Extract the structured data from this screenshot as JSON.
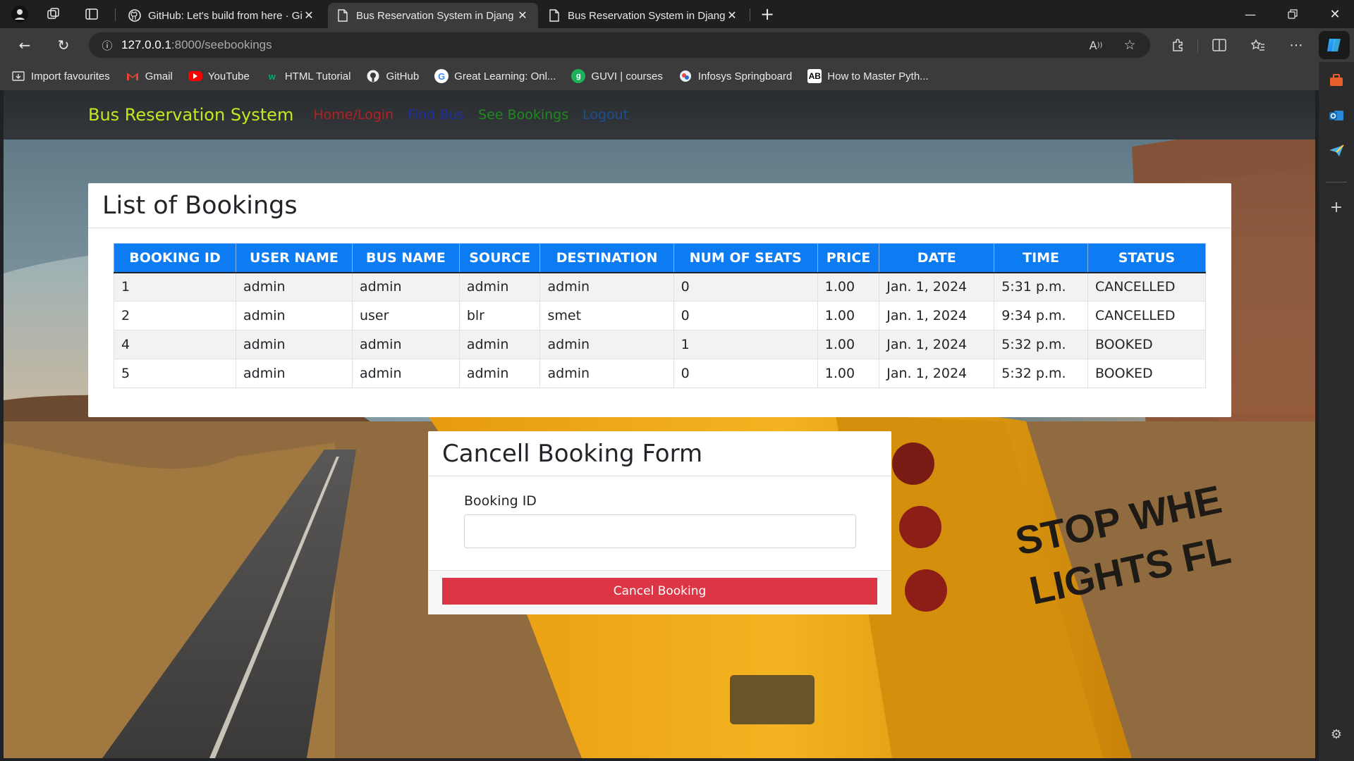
{
  "browser": {
    "tabs": [
      {
        "title": "GitHub: Let's build from here · Gi",
        "icon": "github-icon",
        "active": false
      },
      {
        "title": "Bus Reservation System in Djang",
        "icon": "page-icon",
        "active": true
      },
      {
        "title": "Bus Reservation System in Djang",
        "icon": "page-icon",
        "active": false
      }
    ],
    "new_tab": "+",
    "url_host": "127.0.0.1",
    "url_path": ":8000/seebookings",
    "bookmarks": [
      {
        "label": "Import favourites",
        "icon": "import-icon"
      },
      {
        "label": "Gmail",
        "icon": "gmail-icon"
      },
      {
        "label": "YouTube",
        "icon": "youtube-icon"
      },
      {
        "label": "HTML Tutorial",
        "icon": "w3schools-icon"
      },
      {
        "label": "GitHub",
        "icon": "github-icon"
      },
      {
        "label": "Great Learning: Onl...",
        "icon": "google-icon"
      },
      {
        "label": "GUVI | courses",
        "icon": "guvi-icon"
      },
      {
        "label": "Infosys Springboard",
        "icon": "infosys-icon"
      },
      {
        "label": "How to Master Pyth...",
        "icon": "ab-icon"
      }
    ]
  },
  "navbar": {
    "brand": "Bus Reservation System",
    "links": [
      {
        "label": "Home/Login",
        "color": "#b22222"
      },
      {
        "label": "Find Bus",
        "color": "#1f2f9e"
      },
      {
        "label": "See Bookings",
        "color": "#1e8a1e"
      },
      {
        "label": "Logout",
        "color": "#1d4f8f"
      }
    ]
  },
  "bookings": {
    "title": "List of Bookings",
    "columns": [
      "BOOKING ID",
      "USER NAME",
      "BUS NAME",
      "SOURCE",
      "DESTINATION",
      "NUM OF SEATS",
      "PRICE",
      "DATE",
      "TIME",
      "STATUS"
    ],
    "rows": [
      [
        "1",
        "admin",
        "admin",
        "admin",
        "admin",
        "0",
        "1.00",
        "Jan. 1, 2024",
        "5:31 p.m.",
        "CANCELLED"
      ],
      [
        "2",
        "admin",
        "user",
        "blr",
        "smet",
        "0",
        "1.00",
        "Jan. 1, 2024",
        "9:34 p.m.",
        "CANCELLED"
      ],
      [
        "4",
        "admin",
        "admin",
        "admin",
        "admin",
        "1",
        "1.00",
        "Jan. 1, 2024",
        "5:32 p.m.",
        "BOOKED"
      ],
      [
        "5",
        "admin",
        "admin",
        "admin",
        "admin",
        "0",
        "1.00",
        "Jan. 1, 2024",
        "5:32 p.m.",
        "BOOKED"
      ]
    ]
  },
  "cancel_form": {
    "title": "Cancell Booking Form",
    "field_label": "Booking ID",
    "field_value": "",
    "button_label": "Cancel Booking"
  }
}
